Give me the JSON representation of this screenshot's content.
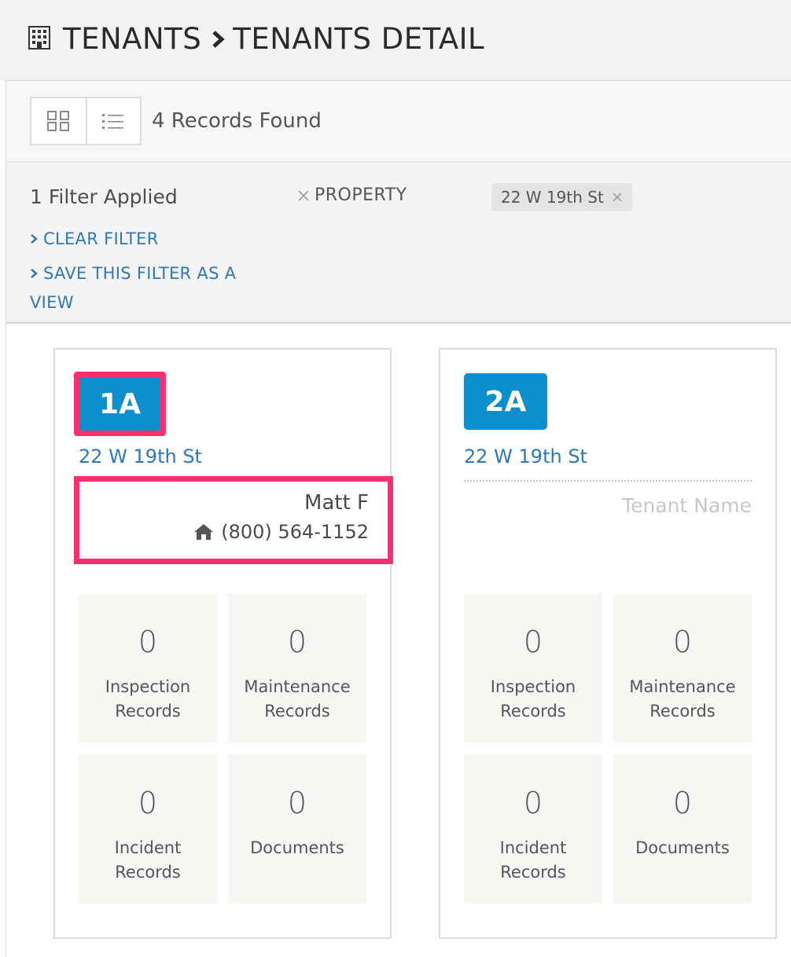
{
  "header": {
    "icon": "building-icon",
    "breadcrumb_root": "TENANTS",
    "breadcrumb_current": "TENANTS DETAIL"
  },
  "toolbar": {
    "records_found": "4 Records Found",
    "view_modes": [
      "grid-view-icon",
      "list-view-icon"
    ]
  },
  "filters": {
    "applied_label": "1 Filter Applied",
    "property_label": "PROPERTY",
    "chip_value": "22 W 19th St",
    "clear_filter": "CLEAR FILTER",
    "save_view": "SAVE THIS FILTER AS A VIEW"
  },
  "cards": [
    {
      "unit": "1A",
      "address": "22 W 19th St",
      "tenant_name": "Matt F",
      "tenant_phone": "(800) 564-1152",
      "stats": [
        {
          "value": "0",
          "label": "Inspection Records"
        },
        {
          "value": "0",
          "label": "Maintenance Records"
        },
        {
          "value": "0",
          "label": "Incident Records"
        },
        {
          "value": "0",
          "label": "Documents"
        }
      ]
    },
    {
      "unit": "2A",
      "address": "22 W 19th St",
      "tenant_placeholder": "Tenant Name",
      "stats": [
        {
          "value": "0",
          "label": "Inspection Records"
        },
        {
          "value": "0",
          "label": "Maintenance Records"
        },
        {
          "value": "0",
          "label": "Incident Records"
        },
        {
          "value": "0",
          "label": "Documents"
        }
      ]
    }
  ],
  "colors": {
    "accent": "#0d8fce",
    "link": "#2d78b8",
    "highlight": "#ff2e6f"
  }
}
